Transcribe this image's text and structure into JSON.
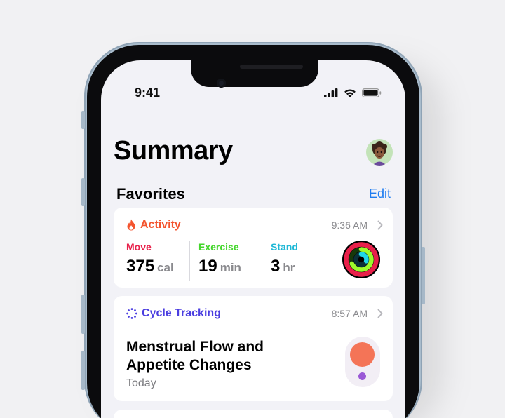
{
  "status_bar": {
    "time": "9:41"
  },
  "header": {
    "title": "Summary"
  },
  "favorites": {
    "label": "Favorites",
    "edit_label": "Edit"
  },
  "activity": {
    "title": "Activity",
    "time": "9:36 AM",
    "accent_color": "#f4542e",
    "metrics": [
      {
        "label": "Move",
        "value": "375",
        "unit": "cal",
        "color": "#e8204a"
      },
      {
        "label": "Exercise",
        "value": "19",
        "unit": "min",
        "color": "#44d62c"
      },
      {
        "label": "Stand",
        "value": "3",
        "unit": "hr",
        "color": "#1fb8d6"
      }
    ]
  },
  "cycle": {
    "title": "Cycle Tracking",
    "time": "8:57 AM",
    "accent_color": "#4b3ee0",
    "headline_line1": "Menstrual Flow and",
    "headline_line2": "Appetite Changes",
    "date_label": "Today"
  },
  "colors": {
    "background": "#f2f2f7",
    "link": "#1e7cf0",
    "flow": "#f47457",
    "symptom": "#9a59d6"
  }
}
